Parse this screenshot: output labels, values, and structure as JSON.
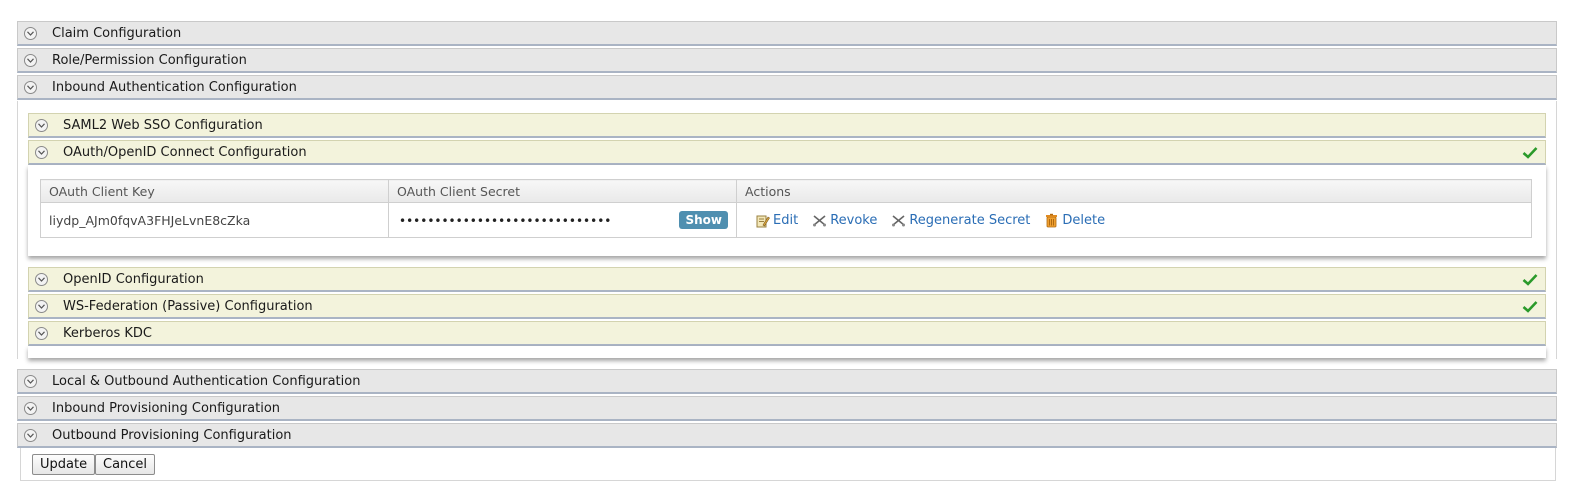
{
  "sections": {
    "claim": "Claim Configuration",
    "role": "Role/Permission Configuration",
    "inbound_auth": "Inbound Authentication Configuration",
    "local_outbound": "Local & Outbound Authentication Configuration",
    "inbound_prov": "Inbound Provisioning Configuration",
    "outbound_prov": "Outbound Provisioning Configuration"
  },
  "inbound": {
    "saml": "SAML2 Web SSO Configuration",
    "oauth": "OAuth/OpenID Connect Configuration",
    "openid": "OpenID Configuration",
    "wsfed": "WS-Federation (Passive) Configuration",
    "kerberos": "Kerberos KDC"
  },
  "oauth_table": {
    "headers": [
      "OAuth Client Key",
      "OAuth Client Secret",
      "Actions"
    ],
    "client_key": "liydp_AJm0fqvA3FHJeLvnE8cZka",
    "client_secret_masked": "••••••••••••••••••••••••••••••",
    "show_label": "Show",
    "actions": {
      "edit": "Edit",
      "revoke": "Revoke",
      "regenerate": "Regenerate Secret",
      "delete": "Delete"
    }
  },
  "buttons": {
    "update": "Update",
    "cancel": "Cancel"
  },
  "colors": {
    "check": "#2a9a2a",
    "link": "#2a6db5",
    "show_btn": "#4f8fb0"
  },
  "icons": {
    "toggle": "chevron-down-icon",
    "status": "checkmark-icon",
    "edit": "edit-icon",
    "revoke": "revoke-icon",
    "delete": "trash-icon"
  }
}
